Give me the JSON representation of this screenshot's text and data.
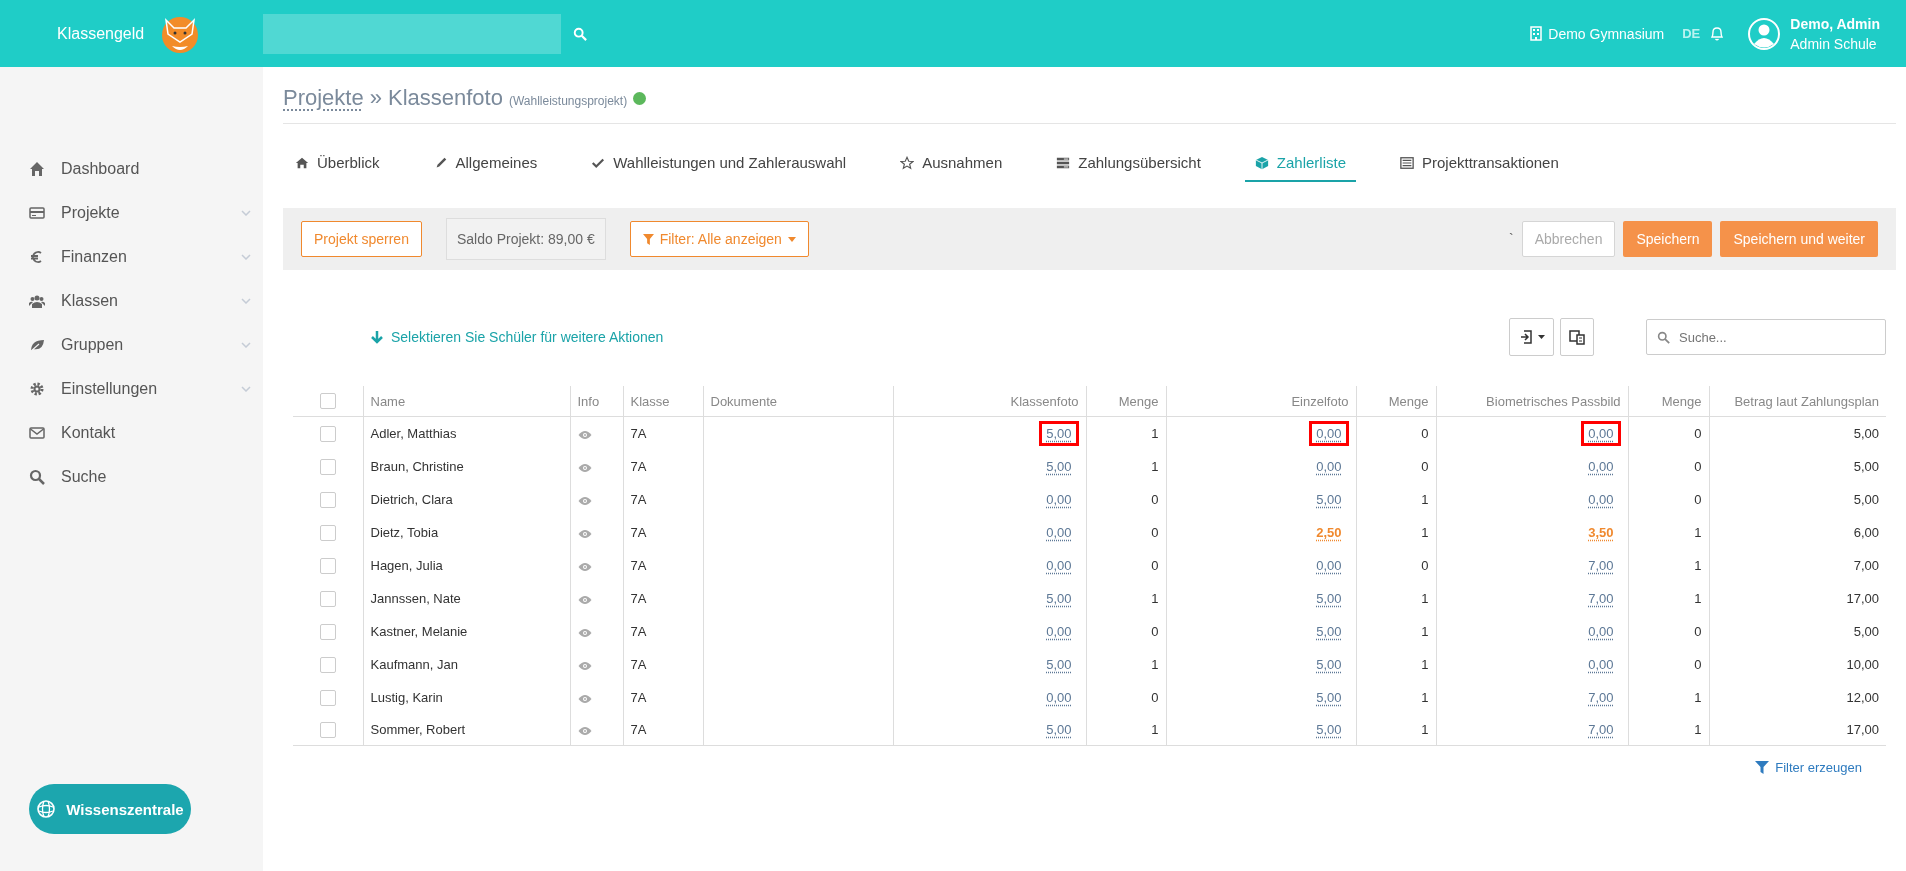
{
  "header": {
    "logo": "Klassengeld",
    "school": "Demo Gymnasium",
    "language": "DE",
    "user": {
      "name": "Demo, Admin",
      "role": "Admin Schule"
    }
  },
  "sidebar": {
    "items": [
      {
        "label": "Dashboard",
        "expandable": false
      },
      {
        "label": "Projekte",
        "expandable": true
      },
      {
        "label": "Finanzen",
        "expandable": true
      },
      {
        "label": "Klassen",
        "expandable": true
      },
      {
        "label": "Gruppen",
        "expandable": true
      },
      {
        "label": "Einstellungen",
        "expandable": true
      },
      {
        "label": "Kontakt",
        "expandable": false
      },
      {
        "label": "Suche",
        "expandable": false
      }
    ],
    "help_button": "Wissenszentrale"
  },
  "breadcrumb": {
    "parent": "Projekte",
    "separator": "»",
    "title": "Klassenfoto",
    "subtitle": "(Wahlleistungsprojekt)"
  },
  "tabs": [
    {
      "label": "Überblick",
      "selected": false
    },
    {
      "label": "Allgemeines",
      "selected": false
    },
    {
      "label": "Wahlleistungen und Zahlerauswahl",
      "selected": false
    },
    {
      "label": "Ausnahmen",
      "selected": false
    },
    {
      "label": "Zahlungsübersicht",
      "selected": false
    },
    {
      "label": "Zahlerliste",
      "selected": true
    },
    {
      "label": "Projekttransaktionen",
      "selected": false
    }
  ],
  "toolbar": {
    "lock_button": "Projekt sperren",
    "balance": "Saldo Projekt: 89,00 €",
    "filter_button": "Filter: Alle anzeigen",
    "stray_mark": "`",
    "cancel_button": {
      "label": "Abbrechen",
      "disabled": true
    },
    "save_button": "Speichern",
    "save_next_button": "Speichern und weiter"
  },
  "table": {
    "hint": "Selektieren Sie Schüler für weitere Aktionen",
    "search": {
      "placeholder": "Suche..."
    },
    "select_all_checked": false,
    "columns": [
      "Name",
      "Info",
      "Klasse",
      "Dokumente",
      "Klassenfoto",
      "Menge",
      "Einzelfoto",
      "Menge",
      "Biometrisches Passbild",
      "Menge",
      "Betrag laut Zahlungsplan"
    ],
    "rows": [
      {
        "checked": false,
        "name": "Adler, Matthias",
        "class": "7A",
        "options": [
          {
            "amount": "5,00",
            "quantity": "1",
            "highlighted": true,
            "changed": false
          },
          {
            "amount": "0,00",
            "quantity": "0",
            "highlighted": true,
            "changed": false
          },
          {
            "amount": "0,00",
            "quantity": "0",
            "highlighted": true,
            "changed": false
          }
        ],
        "total": "5,00"
      },
      {
        "checked": false,
        "name": "Braun, Christine",
        "class": "7A",
        "options": [
          {
            "amount": "5,00",
            "quantity": "1",
            "highlighted": false,
            "changed": false
          },
          {
            "amount": "0,00",
            "quantity": "0",
            "highlighted": false,
            "changed": false
          },
          {
            "amount": "0,00",
            "quantity": "0",
            "highlighted": false,
            "changed": false
          }
        ],
        "total": "5,00"
      },
      {
        "checked": false,
        "name": "Dietrich, Clara",
        "class": "7A",
        "options": [
          {
            "amount": "0,00",
            "quantity": "0",
            "highlighted": false,
            "changed": false
          },
          {
            "amount": "5,00",
            "quantity": "1",
            "highlighted": false,
            "changed": false
          },
          {
            "amount": "0,00",
            "quantity": "0",
            "highlighted": false,
            "changed": false
          }
        ],
        "total": "5,00"
      },
      {
        "checked": false,
        "name": "Dietz, Tobia",
        "class": "7A",
        "options": [
          {
            "amount": "0,00",
            "quantity": "0",
            "highlighted": false,
            "changed": false
          },
          {
            "amount": "2,50",
            "quantity": "1",
            "highlighted": false,
            "changed": true
          },
          {
            "amount": "3,50",
            "quantity": "1",
            "highlighted": false,
            "changed": true
          }
        ],
        "total": "6,00"
      },
      {
        "checked": false,
        "name": "Hagen, Julia",
        "class": "7A",
        "options": [
          {
            "amount": "0,00",
            "quantity": "0",
            "highlighted": false,
            "changed": false
          },
          {
            "amount": "0,00",
            "quantity": "0",
            "highlighted": false,
            "changed": false
          },
          {
            "amount": "7,00",
            "quantity": "1",
            "highlighted": false,
            "changed": false
          }
        ],
        "total": "7,00"
      },
      {
        "checked": false,
        "name": "Jannssen, Nate",
        "class": "7A",
        "options": [
          {
            "amount": "5,00",
            "quantity": "1",
            "highlighted": false,
            "changed": false
          },
          {
            "amount": "5,00",
            "quantity": "1",
            "highlighted": false,
            "changed": false
          },
          {
            "amount": "7,00",
            "quantity": "1",
            "highlighted": false,
            "changed": false
          }
        ],
        "total": "17,00"
      },
      {
        "checked": false,
        "name": "Kastner, Melanie",
        "class": "7A",
        "options": [
          {
            "amount": "0,00",
            "quantity": "0",
            "highlighted": false,
            "changed": false
          },
          {
            "amount": "5,00",
            "quantity": "1",
            "highlighted": false,
            "changed": false
          },
          {
            "amount": "0,00",
            "quantity": "0",
            "highlighted": false,
            "changed": false
          }
        ],
        "total": "5,00"
      },
      {
        "checked": false,
        "name": "Kaufmann, Jan",
        "class": "7A",
        "options": [
          {
            "amount": "5,00",
            "quantity": "1",
            "highlighted": false,
            "changed": false
          },
          {
            "amount": "5,00",
            "quantity": "1",
            "highlighted": false,
            "changed": false
          },
          {
            "amount": "0,00",
            "quantity": "0",
            "highlighted": false,
            "changed": false
          }
        ],
        "total": "10,00"
      },
      {
        "checked": false,
        "name": "Lustig, Karin",
        "class": "7A",
        "options": [
          {
            "amount": "0,00",
            "quantity": "0",
            "highlighted": false,
            "changed": false
          },
          {
            "amount": "5,00",
            "quantity": "1",
            "highlighted": false,
            "changed": false
          },
          {
            "amount": "7,00",
            "quantity": "1",
            "highlighted": false,
            "changed": false
          }
        ],
        "total": "12,00"
      },
      {
        "checked": false,
        "name": "Sommer, Robert",
        "class": "7A",
        "options": [
          {
            "amount": "5,00",
            "quantity": "1",
            "highlighted": false,
            "changed": false
          },
          {
            "amount": "5,00",
            "quantity": "1",
            "highlighted": false,
            "changed": false
          },
          {
            "amount": "7,00",
            "quantity": "1",
            "highlighted": false,
            "changed": false
          }
        ],
        "total": "17,00"
      }
    ],
    "filter_link": "Filter erzeugen"
  }
}
